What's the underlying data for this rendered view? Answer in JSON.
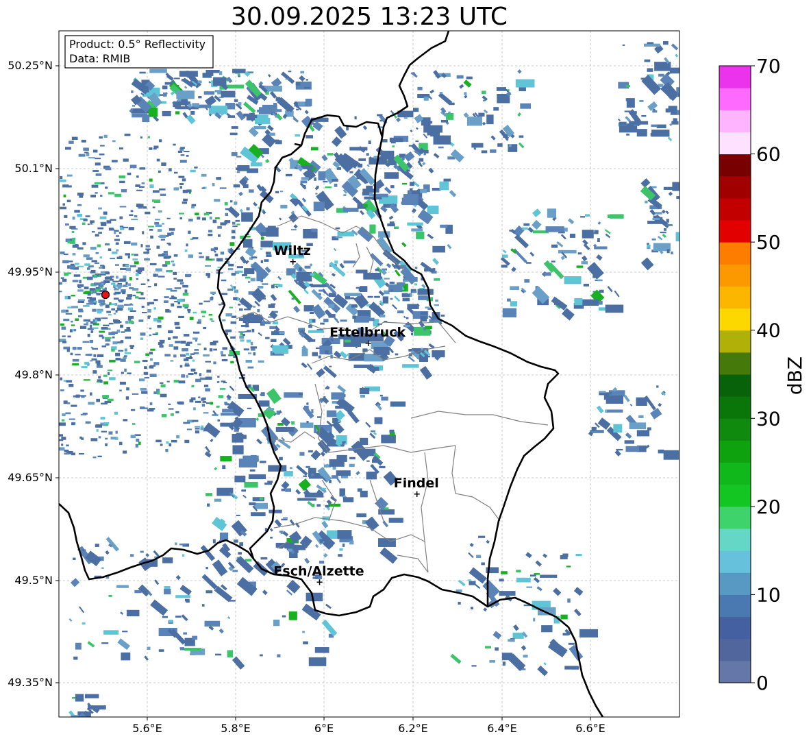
{
  "title": "30.09.2025 13:23 UTC",
  "info_box": {
    "product": "Product: 0.5° Reflectivity",
    "data_source": "Data: RMIB"
  },
  "lat_ticks": [
    "50.25°N",
    "50.1°N",
    "49.95°N",
    "49.8°N",
    "49.65°N",
    "49.5°N",
    "49.35°N"
  ],
  "lon_ticks": [
    "5.6°E",
    "5.8°E",
    "6°E",
    "6.2°E",
    "6.4°E",
    "6.6°E"
  ],
  "cities": [
    {
      "name": "Wiltz",
      "lon": 5.93,
      "lat": 49.966
    },
    {
      "name": "Ettelbruck",
      "lon": 6.1,
      "lat": 49.847
    },
    {
      "name": "Findel",
      "lon": 6.21,
      "lat": 49.627
    },
    {
      "name": "Esch/Alzette",
      "lon": 5.99,
      "lat": 49.499
    }
  ],
  "radar_site": {
    "lon": 5.505,
    "lat": 49.914
  },
  "colorbar": {
    "label": "dBZ",
    "min": 0,
    "max": 70,
    "ticks": [
      "0",
      "10",
      "20",
      "30",
      "40",
      "50",
      "60",
      "70"
    ],
    "colors": [
      "#6577a8",
      "#52669e",
      "#4560a0",
      "#4a78b0",
      "#5899c4",
      "#66c1dc",
      "#64d7c6",
      "#3fd46b",
      "#14c621",
      "#11b81c",
      "#0fa20f",
      "#0f8a0f",
      "#0a760a",
      "#07620a",
      "#457a0a",
      "#afb108",
      "#fcd700",
      "#fcb600",
      "#fc9900",
      "#fc7d00",
      "#e30000",
      "#c30000",
      "#a10000",
      "#790000",
      "#fee1fe",
      "#feb4fe",
      "#fe6afe",
      "#ea33ea"
    ]
  },
  "echo_colors": [
    "#4b6fa3",
    "#5a83b8",
    "#6aa0c8",
    "#5ec4d6",
    "#3cc46a",
    "#18b020"
  ]
}
